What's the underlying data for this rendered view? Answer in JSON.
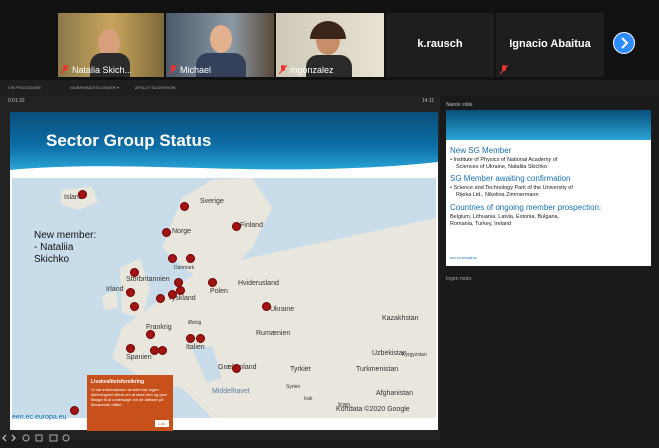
{
  "participants": [
    {
      "name": "Natalia Skich...",
      "muted": true
    },
    {
      "name": "Michael",
      "muted": true
    },
    {
      "name": "mgonzalez",
      "muted": true
    },
    {
      "name": "k.rausch",
      "muted": false
    },
    {
      "name": "Ignacio Abaitua",
      "muted": true
    }
  ],
  "toolbar": {
    "items": [
      "VIS PROCEDURE",
      "SKÆRMINDSTILLINGER ▾",
      "AFSLUT SLIDESHOW"
    ]
  },
  "presenter": {
    "elapsed": "0:01:32",
    "clock": "14:11",
    "slide_title": "Sector Group Status",
    "new_member_line1": "New member:",
    "new_member_line2": "- Nataliia",
    "new_member_line3": "Skichko",
    "footer_url": "een.ec.europa.eu",
    "map_attribution": "Kortdata ©2020 Google",
    "map_labels": [
      "Island",
      "Sverige",
      "Finland",
      "Norge",
      "Danmark",
      "Storbritannien",
      "Hviderusland",
      "Irland",
      "Polen",
      "Tyskland",
      "Ukraine",
      "Kazakhstan",
      "Frankrig",
      "Rumænien",
      "Spanien",
      "Italien",
      "Uzbekistan",
      "Kyrgyzstan",
      "Grækenland",
      "Tyrkiet",
      "Turkmenistan",
      "Syrien",
      "Middelhavet",
      "Afghanistan",
      "Iran",
      "Irak",
      "Østrig"
    ],
    "cookie": {
      "title": "Livskvalitetsforsikring",
      "body": "Vi har informationen at sider har ingen skrivningsret tilbud om at læse den og give tilsagn til at undersøge om de dækker på tilsvarende måde.",
      "button": "Luk"
    }
  },
  "next_slide": {
    "label": "Næste slide",
    "h1": "New SG Member",
    "b1a": "• Institute of Physics of National Academy of",
    "b1b": "Sciences of Ukraine, Nataliia Skichko",
    "h2": "SG Member awaiting confirmation",
    "b2a": "• Science and Technology Park of the University of",
    "b2b": "Rijeka Ltd., Nikolina Zimmermann",
    "h3": "Countries of ongoing member prospection:",
    "b3a": "Belgium, Lithuania, Latvia, Estonia, Bulgaria,",
    "b3b": "Romania, Turkey, Ireland",
    "footer": "een.ec.europa.eu"
  },
  "notes": "Ingen noter.",
  "colors": {
    "accent": "#2d8cff",
    "slide_blue": "#0d6fa8",
    "dot": "#a21313",
    "cookie": "#c8501b"
  }
}
